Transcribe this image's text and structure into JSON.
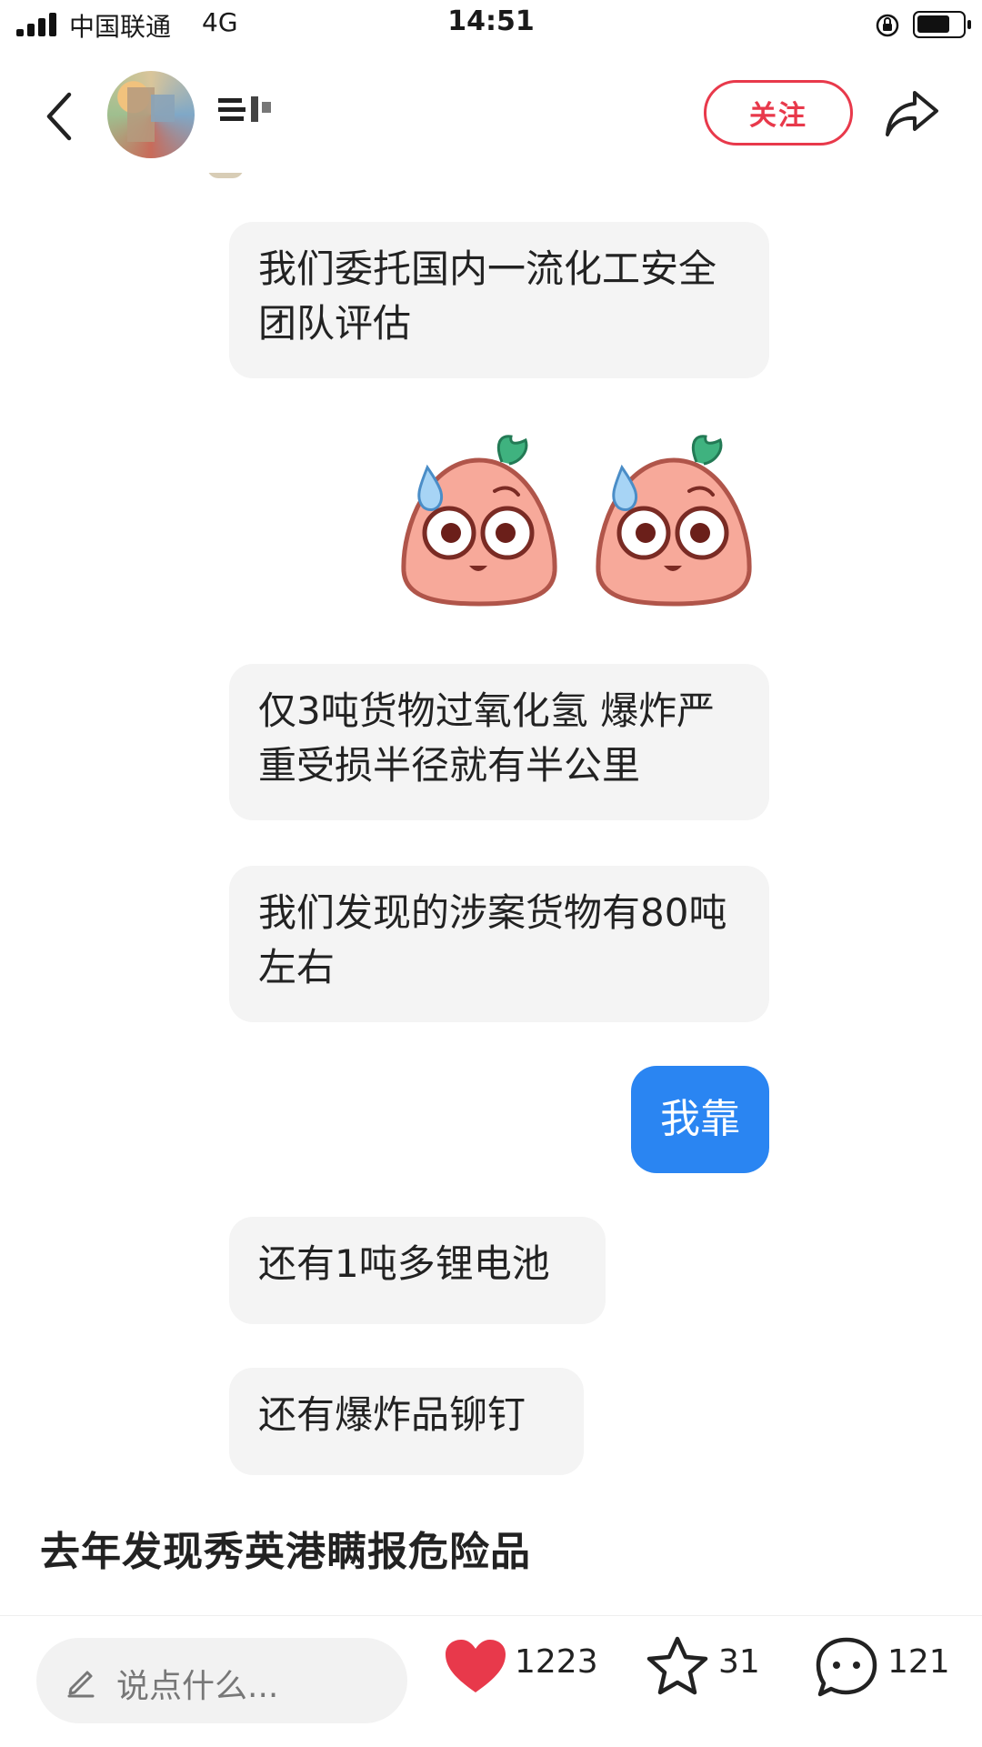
{
  "status_bar": {
    "carrier": "中国联通",
    "network": "4G",
    "time": "14:51",
    "battery_level": 0.75
  },
  "header": {
    "follow_label": "关注",
    "icons": [
      "back-arrow-icon",
      "avatar",
      "share-icon"
    ]
  },
  "chat": {
    "messages": [
      {
        "side": "left",
        "type": "text",
        "text": "我们委托国内一流化工安全团队评估"
      },
      {
        "side": "left",
        "type": "sticker",
        "sticker": "sweating-peach-sticker"
      },
      {
        "side": "left",
        "type": "text",
        "text": "仅3吨货物过氧化氢 爆炸严重受损半径就有半公里"
      },
      {
        "side": "left",
        "type": "text",
        "text": "我们发现的涉案货物有80吨左右"
      },
      {
        "side": "right",
        "type": "text",
        "text": "我靠"
      },
      {
        "side": "left",
        "type": "text",
        "text": "还有1吨多锂电池"
      },
      {
        "side": "left",
        "type": "text",
        "text": "还有爆炸品铆钉"
      }
    ]
  },
  "post": {
    "title": "去年发现秀英港瞒报危险品"
  },
  "bottom_bar": {
    "comment_placeholder": "说点什么...",
    "likes": "1223",
    "favorites": "31",
    "comments": "121",
    "accent_color": "#e8394b"
  },
  "colors": {
    "follow": "#e8394b",
    "my_bubble": "#2a85f2",
    "other_bubble": "#f4f4f4"
  }
}
